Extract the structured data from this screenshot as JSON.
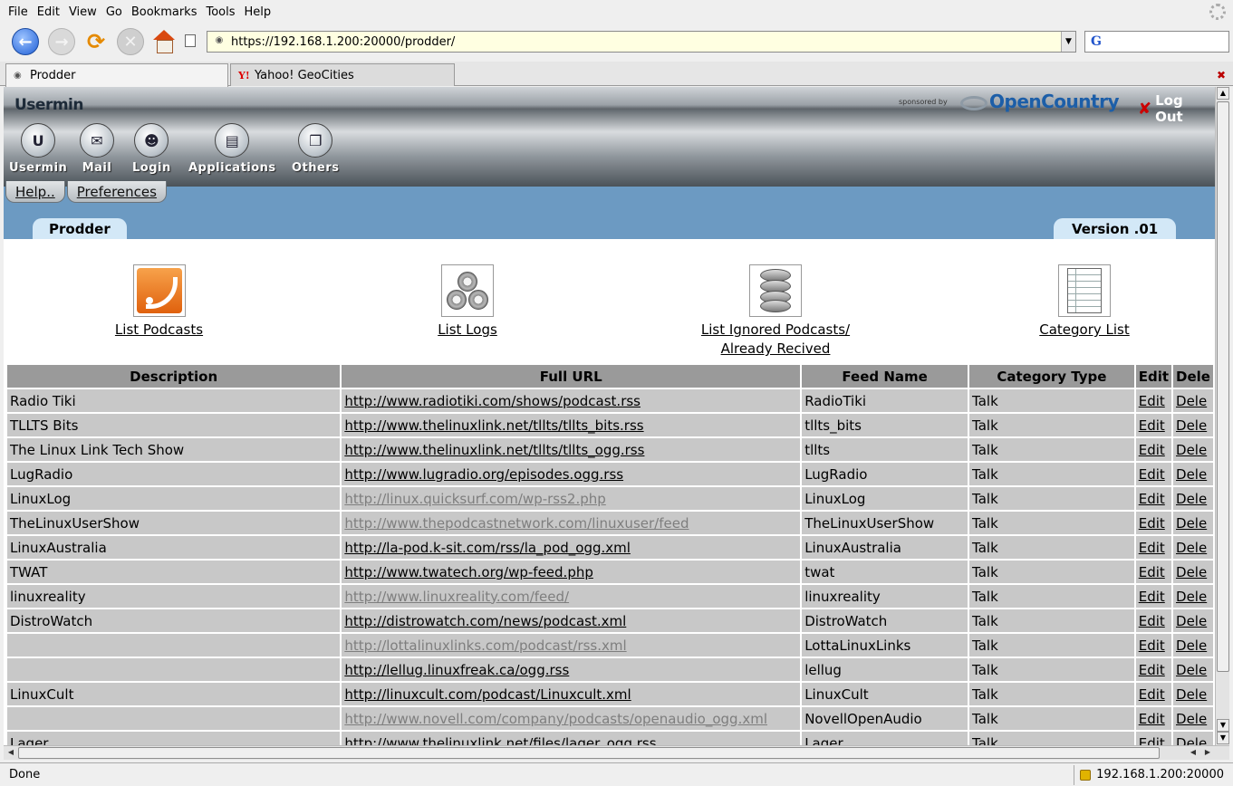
{
  "browser": {
    "menus": [
      "File",
      "Edit",
      "View",
      "Go",
      "Bookmarks",
      "Tools",
      "Help"
    ],
    "url": "https://192.168.1.200:20000/prodder/",
    "search_engine_glyph": "G",
    "tabs": [
      {
        "label": "Prodder",
        "icon": "usermin-favicon",
        "active": true
      },
      {
        "label": "Yahoo! GeoCities",
        "icon": "yahoo-favicon",
        "active": false
      }
    ],
    "status_text": "Done",
    "status_host": "192.168.1.200:20000"
  },
  "usermin": {
    "logo": "Usermin",
    "sponsored_by": "sponsored by",
    "sponsor_name": "OpenCountry",
    "logout_label": "Log Out",
    "categories": [
      {
        "label": "Usermin",
        "icon": "usermin-icon"
      },
      {
        "label": "Mail",
        "icon": "mail-icon"
      },
      {
        "label": "Login",
        "icon": "login-icon"
      },
      {
        "label": "Applications",
        "icon": "applications-icon"
      },
      {
        "label": "Others",
        "icon": "others-icon"
      }
    ],
    "links": [
      "Help..",
      "Preferences"
    ],
    "module_title": "Prodder",
    "version": "Version .01"
  },
  "actions": [
    {
      "label": "List Podcasts",
      "icon": "rss-icon"
    },
    {
      "label": "List Logs",
      "icon": "logs-icon"
    },
    {
      "label": "List Ignored Podcasts/ Already Recived",
      "icon": "database-icon"
    },
    {
      "label": "Category List",
      "icon": "spreadsheet-icon"
    }
  ],
  "table": {
    "headers": [
      "Description",
      "Full URL",
      "Feed Name",
      "Category Type",
      "Edit",
      "Dele"
    ],
    "rows": [
      {
        "description": "Radio Tiki",
        "url": "http://www.radiotiki.com/shows/podcast.rss",
        "visited": false,
        "feed": "RadioTiki",
        "category": "Talk"
      },
      {
        "description": "TLLTS Bits",
        "url": "http://www.thelinuxlink.net/tllts/tllts_bits.rss",
        "visited": false,
        "feed": "tllts_bits",
        "category": "Talk"
      },
      {
        "description": "The Linux Link Tech Show",
        "url": "http://www.thelinuxlink.net/tllts/tllts_ogg.rss",
        "visited": false,
        "feed": "tllts",
        "category": "Talk"
      },
      {
        "description": "LugRadio",
        "url": "http://www.lugradio.org/episodes.ogg.rss",
        "visited": false,
        "feed": "LugRadio",
        "category": "Talk"
      },
      {
        "description": "LinuxLog",
        "url": "http://linux.quicksurf.com/wp-rss2.php",
        "visited": true,
        "feed": "LinuxLog",
        "category": "Talk"
      },
      {
        "description": "TheLinuxUserShow",
        "url": "http://www.thepodcastnetwork.com/linuxuser/feed",
        "visited": true,
        "feed": "TheLinuxUserShow",
        "category": "Talk"
      },
      {
        "description": "LinuxAustralia",
        "url": "http://la-pod.k-sit.com/rss/la_pod_ogg.xml",
        "visited": false,
        "feed": "LinuxAustralia",
        "category": "Talk"
      },
      {
        "description": "TWAT",
        "url": "http://www.twatech.org/wp-feed.php",
        "visited": false,
        "feed": "twat",
        "category": "Talk"
      },
      {
        "description": "linuxreality",
        "url": "http://www.linuxreality.com/feed/",
        "visited": true,
        "feed": "linuxreality",
        "category": "Talk"
      },
      {
        "description": "DistroWatch",
        "url": "http://distrowatch.com/news/podcast.xml",
        "visited": false,
        "feed": "DistroWatch",
        "category": "Talk"
      },
      {
        "description": "",
        "url": "http://lottalinuxlinks.com/podcast/rss.xml",
        "visited": true,
        "feed": "LottaLinuxLinks",
        "category": "Talk"
      },
      {
        "description": "",
        "url": "http://lellug.linuxfreak.ca/ogg.rss",
        "visited": false,
        "feed": "lellug",
        "category": "Talk"
      },
      {
        "description": "LinuxCult",
        "url": "http://linuxcult.com/podcast/Linuxcult.xml",
        "visited": false,
        "feed": "LinuxCult",
        "category": "Talk"
      },
      {
        "description": "",
        "url": "http://www.novell.com/company/podcasts/openaudio_ogg.xml",
        "visited": true,
        "feed": "NovellOpenAudio",
        "category": "Talk"
      },
      {
        "description": "Lager",
        "url": "http://www.thelinuxlink.net/files/lager_ogg.rss",
        "visited": false,
        "feed": "Lager",
        "category": "Talk"
      }
    ],
    "edit_label": "Edit",
    "delete_label": "Dele"
  }
}
